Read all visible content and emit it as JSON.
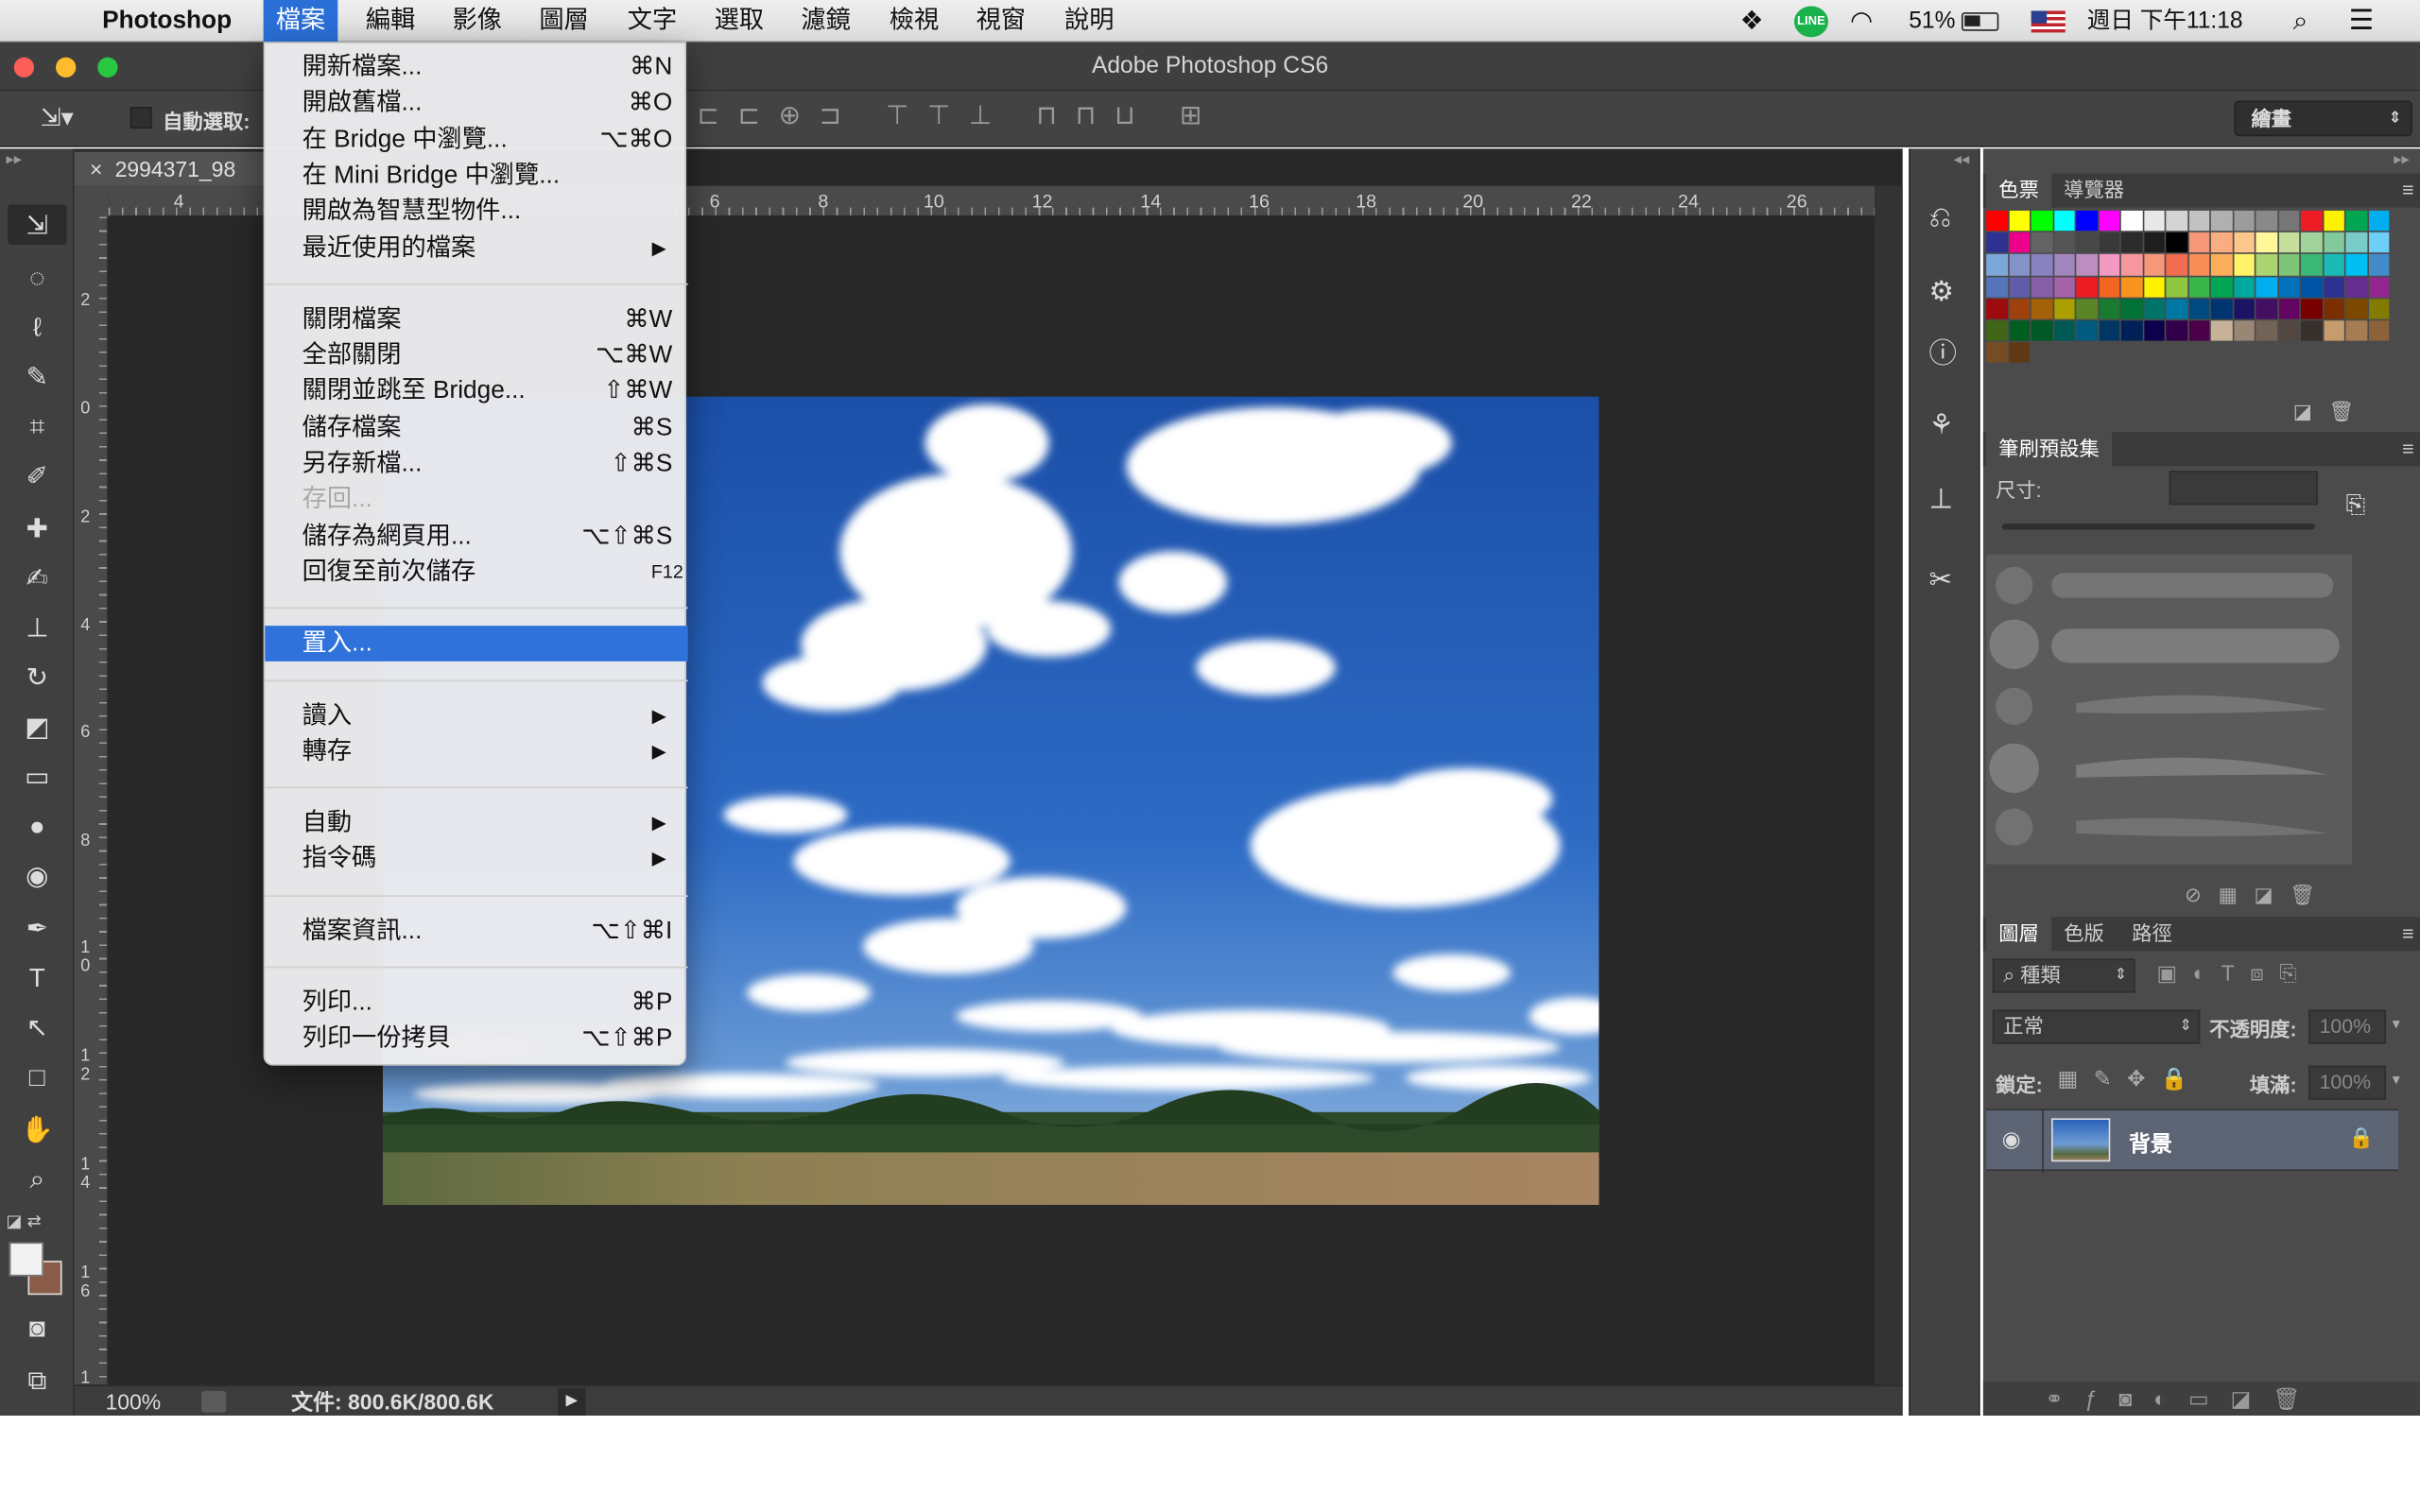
{
  "menubar": {
    "app": "Photoshop",
    "menus": [
      "檔案",
      "編輯",
      "影像",
      "圖層",
      "文字",
      "選取",
      "濾鏡",
      "檢視",
      "視窗",
      "說明"
    ],
    "battery": "51%",
    "clock": "週日 下午11:18"
  },
  "window": {
    "title": "Adobe Photoshop CS6"
  },
  "options": {
    "auto_select_label": "自動選取:",
    "workspace": "繪畫"
  },
  "document": {
    "tab": "2994371_98",
    "zoom": "100%",
    "file_info": "文件: 800.6K/800.6K"
  },
  "ruler": {
    "h_ticks": [
      "4",
      "6",
      "8",
      "10",
      "12",
      "14",
      "16",
      "18",
      "20",
      "22",
      "24",
      "26"
    ],
    "v_ticks": [
      "2",
      "0",
      "2",
      "4",
      "6",
      "8",
      "1\n0",
      "1\n2",
      "1\n4",
      "1\n6",
      "1"
    ]
  },
  "file_menu": {
    "groups": [
      [
        {
          "label": "開新檔案...",
          "shortcut": "⌘N",
          "submenu": false
        },
        {
          "label": "開啟舊檔...",
          "shortcut": "⌘O",
          "submenu": false
        },
        {
          "label": "在 Bridge 中瀏覽...",
          "shortcut": "⌥⌘O",
          "submenu": false
        },
        {
          "label": "在 Mini Bridge 中瀏覽...",
          "shortcut": "",
          "submenu": false
        },
        {
          "label": "開啟為智慧型物件...",
          "shortcut": "",
          "submenu": false
        },
        {
          "label": "最近使用的檔案",
          "shortcut": "▶",
          "submenu": true
        }
      ],
      [
        {
          "label": "關閉檔案",
          "shortcut": "⌘W",
          "submenu": false
        },
        {
          "label": "全部關閉",
          "shortcut": "⌥⌘W",
          "submenu": false
        },
        {
          "label": "關閉並跳至 Bridge...",
          "shortcut": "⇧⌘W",
          "submenu": false
        },
        {
          "label": "儲存檔案",
          "shortcut": "⌘S",
          "submenu": false
        },
        {
          "label": "另存新檔...",
          "shortcut": "⇧⌘S",
          "submenu": false
        },
        {
          "label": "存回...",
          "shortcut": "",
          "submenu": false,
          "disabled": true
        },
        {
          "label": "儲存為網頁用...",
          "shortcut": "⌥⇧⌘S",
          "submenu": false
        },
        {
          "label": "回復至前次儲存",
          "shortcut": "F12",
          "submenu": false
        }
      ],
      [
        {
          "label": "置入...",
          "shortcut": "",
          "submenu": false,
          "highlighted": true
        }
      ],
      [
        {
          "label": "讀入",
          "shortcut": "▶",
          "submenu": true
        },
        {
          "label": "轉存",
          "shortcut": "▶",
          "submenu": true
        }
      ],
      [
        {
          "label": "自動",
          "shortcut": "▶",
          "submenu": true
        },
        {
          "label": "指令碼",
          "shortcut": "▶",
          "submenu": true
        }
      ],
      [
        {
          "label": "檔案資訊...",
          "shortcut": "⌥⇧⌘I",
          "submenu": false
        }
      ],
      [
        {
          "label": "列印...",
          "shortcut": "⌘P",
          "submenu": false
        },
        {
          "label": "列印一份拷貝",
          "shortcut": "⌥⇧⌘P",
          "submenu": false
        }
      ]
    ]
  },
  "panels": {
    "swatches_tabs": [
      "色票",
      "導覽器"
    ],
    "brush_tab": "筆刷預設集",
    "brush_size_label": "尺寸:",
    "layers_tabs": [
      "圖層",
      "色版",
      "路徑"
    ],
    "kind_filter": "種類",
    "blend_mode": "正常",
    "opacity_label": "不透明度:",
    "opacity_value": "100%",
    "lock_label": "鎖定:",
    "fill_label": "填滿:",
    "fill_value": "100%",
    "layer_name": "背景"
  },
  "swatch_colors": [
    "#ff0000",
    "#ffff00",
    "#00ff00",
    "#00ffff",
    "#0000ff",
    "#ff00ff",
    "#ffffff",
    "#e8e8e8",
    "#d4d4d4",
    "#c2c2c2",
    "#b0b0b0",
    "#9c9c9c",
    "#898989",
    "#767676",
    "#ee1c24",
    "#fff200",
    "#00a651",
    "#00aeef",
    "#2e3192",
    "#ec008c",
    "#636363",
    "#555555",
    "#474747",
    "#393939",
    "#2c2c2c",
    "#1e1e1e",
    "#000000",
    "#f7977a",
    "#fbad82",
    "#fdc68c",
    "#fff799",
    "#c4df9b",
    "#a3d39c",
    "#82ca9c",
    "#7accc8",
    "#6dcff6",
    "#7da7d9",
    "#8493ca",
    "#8882be",
    "#a187be",
    "#bc8dbf",
    "#f49ac2",
    "#f6989d",
    "#f7977a",
    "#f26c4f",
    "#f68e56",
    "#fbaf5c",
    "#fff467",
    "#acd372",
    "#7cc576",
    "#3bb878",
    "#1abbb4",
    "#00bff3",
    "#438ccb",
    "#5574b9",
    "#605ca8",
    "#855fa8",
    "#a763a9",
    "#ed1c24",
    "#f26522",
    "#f7941d",
    "#fff200",
    "#8dc63f",
    "#39b54a",
    "#00a651",
    "#00a99d",
    "#00aeef",
    "#0072bc",
    "#0054a6",
    "#2e3192",
    "#662d91",
    "#92278f",
    "#9e0b0f",
    "#a0410d",
    "#a36209",
    "#aba000",
    "#598527",
    "#197b30",
    "#007236",
    "#00746b",
    "#0076a3",
    "#004a80",
    "#003471",
    "#1b1464",
    "#440e62",
    "#630460",
    "#790000",
    "#7b2e00",
    "#7d4900",
    "#827b00",
    "#406618",
    "#005e20",
    "#005826",
    "#005952",
    "#005b7f",
    "#003663",
    "#002157",
    "#0d004c",
    "#32004b",
    "#4b0049",
    "#c7b299",
    "#998675",
    "#736357",
    "#534741",
    "#37302d",
    "#c69c6d",
    "#a67c52",
    "#8c6239",
    "#754c24",
    "#603913"
  ]
}
